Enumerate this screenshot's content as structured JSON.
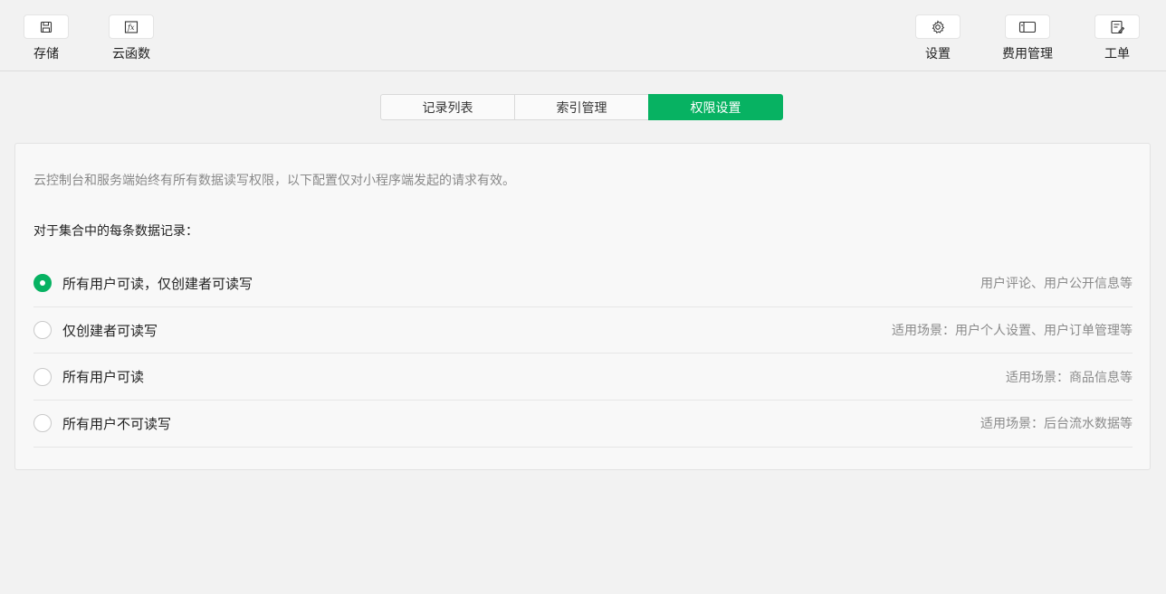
{
  "toolbar": {
    "left": [
      {
        "label": "存储",
        "icon": "save-icon"
      },
      {
        "label": "云函数",
        "icon": "function-icon"
      }
    ],
    "right": [
      {
        "label": "设置",
        "icon": "gear-icon"
      },
      {
        "label": "费用管理",
        "icon": "billing-icon"
      },
      {
        "label": "工单",
        "icon": "ticket-icon"
      }
    ]
  },
  "tabs": [
    {
      "label": "记录列表",
      "active": false
    },
    {
      "label": "索引管理",
      "active": false
    },
    {
      "label": "权限设置",
      "active": true
    }
  ],
  "permissions": {
    "description": "云控制台和服务端始终有所有数据读写权限，以下配置仅对小程序端发起的请求有效。",
    "section_title": "对于集合中的每条数据记录：",
    "options": [
      {
        "label": "所有用户可读，仅创建者可读写",
        "hint": "用户评论、用户公开信息等",
        "selected": true
      },
      {
        "label": "仅创建者可读写",
        "hint": "适用场景：用户个人设置、用户订单管理等",
        "selected": false
      },
      {
        "label": "所有用户可读",
        "hint": "适用场景：商品信息等",
        "selected": false
      },
      {
        "label": "所有用户不可读写",
        "hint": "适用场景：后台流水数据等",
        "selected": false
      }
    ]
  },
  "colors": {
    "accent": "#07b262",
    "background": "#f2f2f2",
    "panel": "#f8f8f8"
  }
}
